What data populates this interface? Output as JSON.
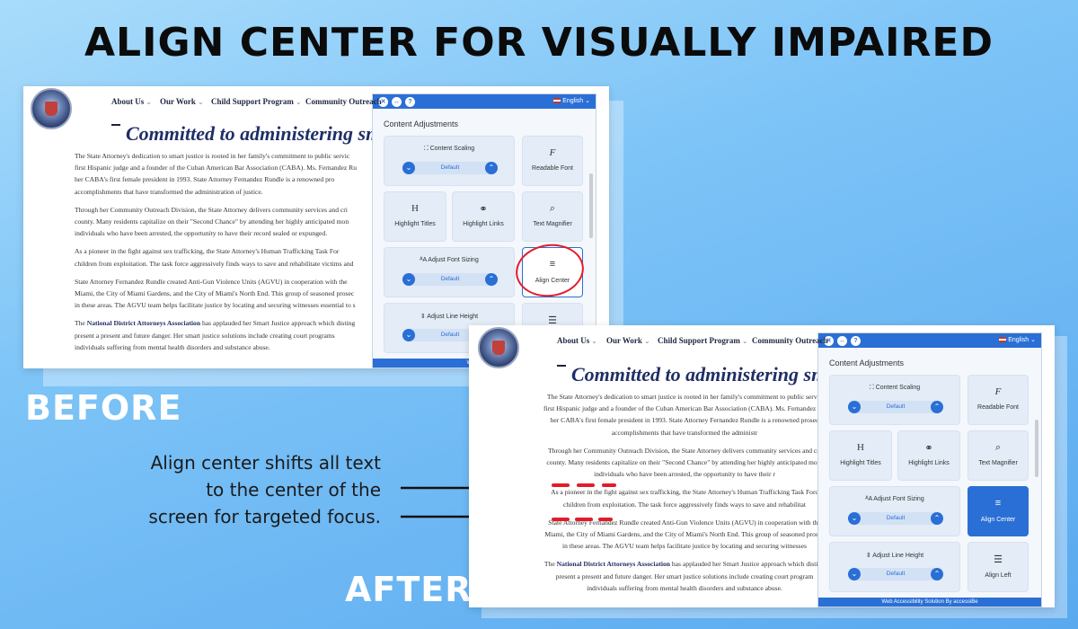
{
  "headline": "ALIGN CENTER FOR VISUALLY IMPAIRED",
  "labels": {
    "before": "BEFORE",
    "after": "AFTER"
  },
  "caption": [
    "Align center shifts all text",
    "to the center of the",
    "screen for targeted focus."
  ],
  "site": {
    "nav": [
      "About Us",
      "Our Work",
      "Child Support Program",
      "Community Outreach"
    ],
    "heading": "Committed to administering sm",
    "paragraphs_before": [
      [
        "The State Attorney's dedication to smart justice is rooted in her family's commitment to public servic",
        "first Hispanic judge and a founder of the Cuban American Bar Association (CABA). Ms. Fernandez Ru",
        "her CABA's first female president in 1993. State Attorney Fernandez Rundle is a renowned pro",
        "accomplishments that have transformed the administration of justice."
      ],
      [
        "Through her Community Outreach Division, the State Attorney delivers community services and cri",
        "county. Many residents capitalize on their \"Second Chance\" by attending her highly anticipated mon",
        "individuals who have been arrested, the opportunity to have their record sealed or expunged."
      ],
      [
        "As a pioneer in the fight against sex trafficking, the State Attorney's Human Trafficking Task For",
        "children from exploitation. The task force aggressively finds ways to save and rehabilitate victims and"
      ],
      [
        "State Attorney Fernandez Rundle created Anti-Gun Violence Units (AGVU) in cooperation with the",
        "Miami, the City of Miami Gardens, and the City of Miami's North End. This group of seasoned prosec",
        "in these areas. The AGVU team helps facilitate justice by locating and securing witnesses essential to s"
      ],
      [
        "The |National District Attorneys Association| has applauded her Smart Justice approach which disting",
        "present a present and future danger. Her smart justice solutions include creating court programs",
        "individuals suffering from mental health disorders and substance abuse."
      ]
    ],
    "paragraphs_after": [
      [
        "The State Attorney's dedication to smart justice is rooted in her family's commitment to public servic",
        "first Hispanic judge and a founder of the Cuban American Bar Association (CABA). Ms. Fernandez Ru",
        "her CABA's first female president in 1993. State Attorney Fernandez Rundle is a renowned prosec",
        "accomplishments that have transformed the administr"
      ],
      [
        "Through her Community Outreach Division, the State Attorney delivers community services and cri",
        "county. Many residents capitalize on their \"Second Chance\" by attending her highly anticipated mont",
        "individuals who have been arrested, the opportunity to have their r"
      ],
      [
        "As a pioneer in the fight against sex trafficking, the State Attorney's Human Trafficking Task Forc",
        "children from exploitation. The task force aggressively finds ways to save and rehabilitat"
      ],
      [
        "State Attorney Fernandez Rundle created Anti-Gun Violence Units (AGVU) in cooperation with the",
        "Miami, the City of Miami Gardens, and the City of Miami's North End. This group of seasoned prosec",
        "in these areas. The AGVU team helps facilitate justice by locating and securing witnesses"
      ],
      [
        "The |National District Attorneys Association| has applauded her Smart Justice approach which disting",
        "present a present and future danger. Her smart justice solutions include creating court program",
        "individuals suffering from mental health disorders and substance abuse."
      ]
    ]
  },
  "widget": {
    "language": "English",
    "title": "Content Adjustments",
    "tiles": {
      "content_scaling": "Content Scaling",
      "readable_font": "Readable Font",
      "highlight_titles": "Highlight Titles",
      "highlight_links": "Highlight Links",
      "text_magnifier": "Text Magnifier",
      "adjust_font_sizing": "Adjust Font Sizing",
      "align_center": "Align Center",
      "adjust_line_height": "Adjust Line Height",
      "align_left": "Align Left"
    },
    "stepper_default": "Default",
    "footer_before": "Web Accessibi",
    "footer_after": "Web Accessibility Solution By accessiBe"
  },
  "colors": {
    "accent": "#2a6fd6",
    "highlight": "#e11d2a",
    "heading": "#1f2f66"
  }
}
